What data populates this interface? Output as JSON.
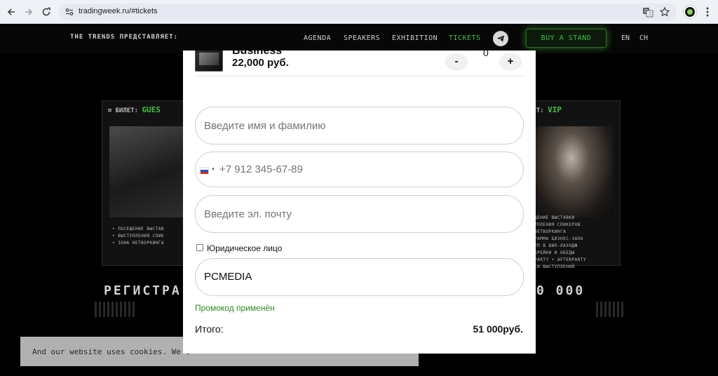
{
  "browser": {
    "url": "tradingweek.ru/#tickets",
    "icons": [
      "back-icon",
      "forward-icon",
      "reload-icon",
      "site-settings-icon",
      "translate-icon",
      "bookmark-star-icon",
      "profile-icon",
      "menu-icon"
    ]
  },
  "header": {
    "brand": "THE TRENDS ПРЕДСТАВЛЯЕТ:",
    "nav": [
      "AGENDA",
      "SPEAKERS",
      "EXHIBITION",
      "TICKETS"
    ],
    "active_nav": "TICKETS",
    "cta": "BUY A STAND",
    "languages": [
      "EN",
      "CH"
    ],
    "accent_color": "#3ec33b"
  },
  "background": {
    "left_card": {
      "prefix": "БИЛЕТ:",
      "title": "GUES",
      "features": [
        "• ПОСЕЩЕНИЕ ВЫСТАВ",
        "• ВЫСТУПЛЕНИЯ СПИК",
        "• ЗОНА НЕТВОРКИНГА"
      ]
    },
    "right_card": {
      "prefix": "ЛЕТ:",
      "title": "VIP",
      "features": [
        "ЩЕНИЕ ВЫСТАВКИ",
        "УПЛЕНИЯ СПИКЕРОВ",
        "НЕТВОРКИНГА",
        "РАММА БИЗНЕС-ЗАЛА",
        "УП В ВИП-ЛАУНДЖ",
        "БРЕЙКИ И ОБЕДЫ",
        "PARTY • AFTERPARTY",
        "СИ ВЫСТУПЛЕНИЙ"
      ]
    },
    "left_heading": "РЕГИСТРА",
    "right_heading": "0 000"
  },
  "cookie_banner": {
    "text": "And our website uses cookies. We c"
  },
  "modal": {
    "product": {
      "name_cut": "Business",
      "price": "22,000 руб.",
      "qty": "0",
      "minus": "-",
      "plus": "+"
    },
    "form": {
      "name_placeholder": "Введите имя и фамилию",
      "phone_placeholder": "+7 912 345-67-89",
      "email_placeholder": "Введите эл. почту",
      "legal_entity_label": "Юридическое лицо",
      "legal_entity_checked": false,
      "promo_value": "PCMEDIA",
      "promo_status": "Промокод применён"
    },
    "total": {
      "label": "Итого:",
      "value": "51 000руб."
    }
  }
}
